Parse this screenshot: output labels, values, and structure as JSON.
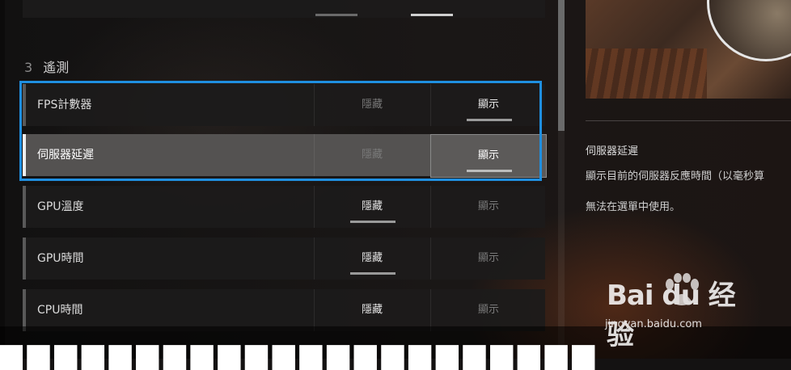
{
  "section": {
    "number": "3",
    "title": "遙測"
  },
  "rows": [
    {
      "label": "FPS計數器",
      "hide": "隱藏",
      "show": "顯示",
      "selected": "show"
    },
    {
      "label": "伺服器延遲",
      "hide": "隱藏",
      "show": "顯示",
      "selected": "show"
    },
    {
      "label": "GPU溫度",
      "hide": "隱藏",
      "show": "顯示",
      "selected": "hide"
    },
    {
      "label": "GPU時間",
      "hide": "隱藏",
      "show": "顯示",
      "selected": "hide"
    },
    {
      "label": "CPU時間",
      "hide": "隱藏",
      "show": "顯示",
      "selected": "hide"
    }
  ],
  "info": {
    "title": "伺服器延遲",
    "description": "顯示目前的伺服器反應時間（以毫秒算",
    "note": "無法在選單中使用。"
  },
  "watermark": {
    "brand": "Bai du 经验",
    "url": "jingyan.baidu.com"
  },
  "colors": {
    "highlight": "#1f8fe0",
    "active_row": "#545251"
  }
}
